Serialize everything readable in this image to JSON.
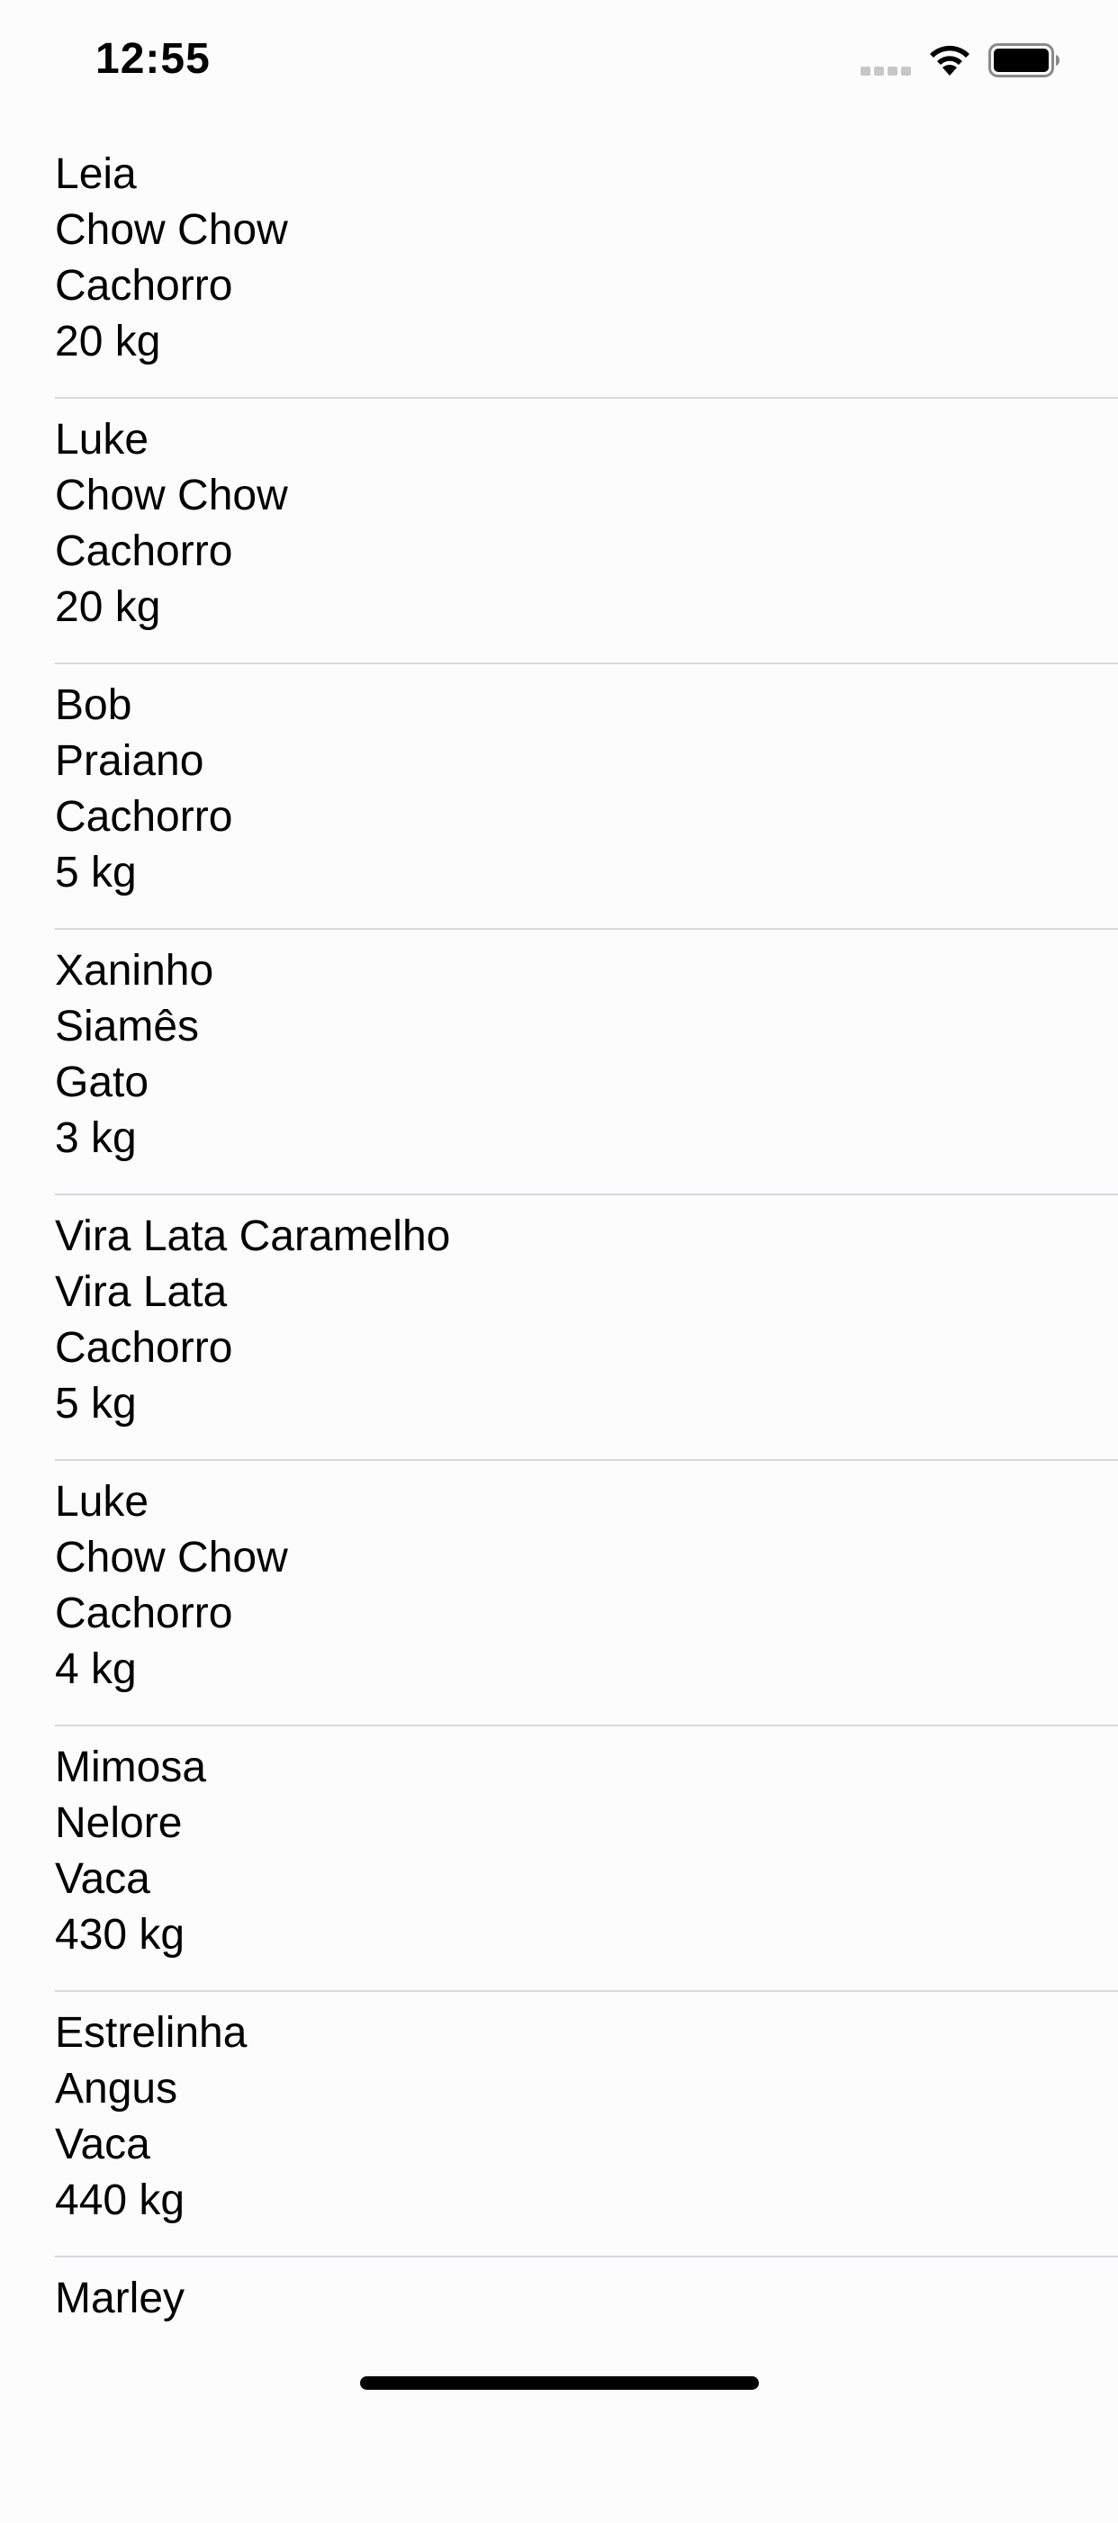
{
  "status_bar": {
    "time": "12:55",
    "icons": [
      "cellular-signal-icon",
      "wifi-icon",
      "battery-icon"
    ]
  },
  "animals": [
    {
      "name": "Leia",
      "breed": "Chow Chow",
      "species": "Cachorro",
      "weight": "20 kg"
    },
    {
      "name": "Luke",
      "breed": "Chow Chow",
      "species": "Cachorro",
      "weight": "20 kg"
    },
    {
      "name": "Bob",
      "breed": "Praiano",
      "species": "Cachorro",
      "weight": "5 kg"
    },
    {
      "name": "Xaninho",
      "breed": "Siamês",
      "species": "Gato",
      "weight": "3 kg"
    },
    {
      "name": "Vira Lata Caramelho",
      "breed": "Vira Lata",
      "species": "Cachorro",
      "weight": "5 kg"
    },
    {
      "name": "Luke",
      "breed": "Chow Chow",
      "species": "Cachorro",
      "weight": "4 kg"
    },
    {
      "name": "Mimosa",
      "breed": "Nelore",
      "species": "Vaca",
      "weight": "430 kg"
    },
    {
      "name": "Estrelinha",
      "breed": "Angus",
      "species": "Vaca",
      "weight": "440 kg"
    },
    {
      "name": "Marley"
    }
  ],
  "colors": {
    "background": "#fcfcfc",
    "separator": "#d9d9de",
    "text": "#000000"
  }
}
